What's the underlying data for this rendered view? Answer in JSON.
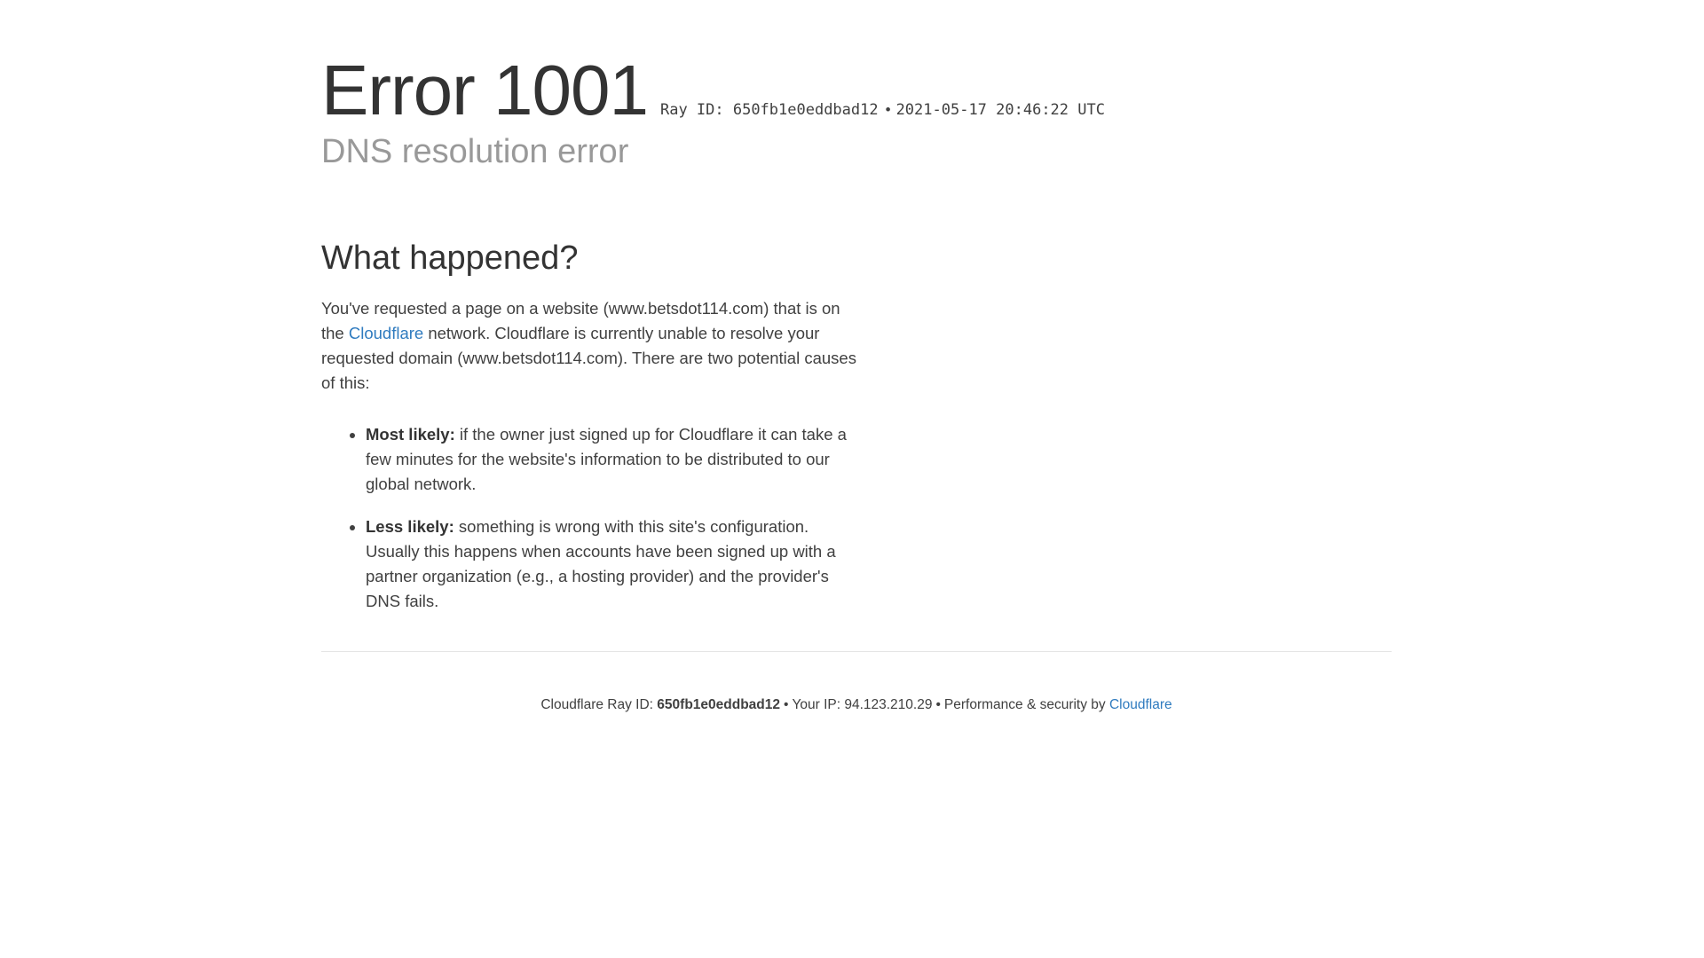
{
  "header": {
    "error_code": "Error 1001",
    "ray_label": "Ray ID: 650fb1e0eddbad12",
    "separator": "•",
    "timestamp": "2021-05-17 20:46:22 UTC",
    "subtitle": "DNS resolution error"
  },
  "what_happened": {
    "title": "What happened?",
    "para_before_link": "You've requested a page on a website (www.betsdot114.com) that is on the ",
    "link_label": "Cloudflare",
    "para_after_link": " network. Cloudflare is currently unable to resolve your requested domain (www.betsdot114.com). There are two potential causes of this:",
    "causes": [
      {
        "label": "Most likely:",
        "text": " if the owner just signed up for Cloudflare it can take a few minutes for the website's information to be distributed to our global network."
      },
      {
        "label": "Less likely:",
        "text": " something is wrong with this site's configuration. Usually this happens when accounts have been signed up with a partner organization (e.g., a hosting provider) and the provider's DNS fails."
      }
    ]
  },
  "footer": {
    "ray_prefix": "Cloudflare Ray ID: ",
    "ray_id": "650fb1e0eddbad12",
    "separator": "•",
    "ip_text": "Your IP: 94.123.210.29",
    "perf_text": "Performance & security by ",
    "link_label": "Cloudflare"
  },
  "colors": {
    "link": "#2f7bbf",
    "heading": "#333333",
    "subtitle": "#999999",
    "body": "#404040",
    "divider": "#e5e5e5"
  }
}
